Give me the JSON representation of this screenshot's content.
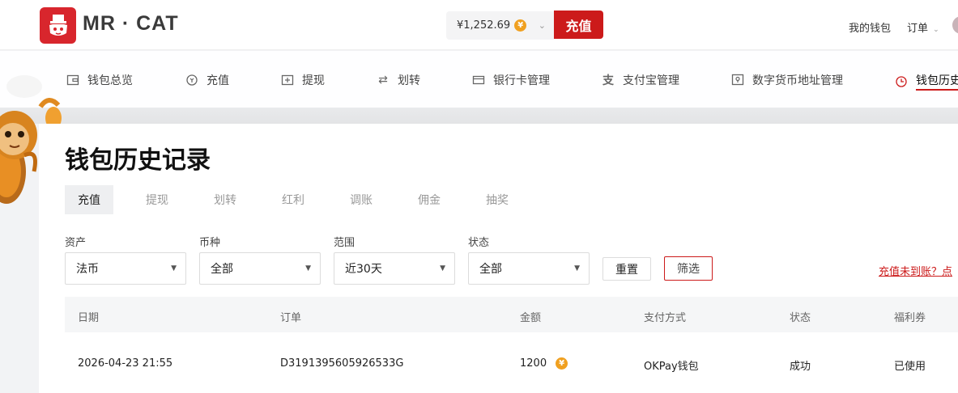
{
  "header": {
    "brand": "MR · CAT",
    "balance": "¥1,252.69",
    "coin_symbol": "¥",
    "recharge_label": "充值",
    "my_wallet": "我的钱包",
    "orders": "订单",
    "accent_color": "#cc1a1a"
  },
  "nav": {
    "items": [
      {
        "label": "钱包总览",
        "icon": "wallet-icon"
      },
      {
        "label": "充值",
        "icon": "recharge-icon"
      },
      {
        "label": "提现",
        "icon": "withdraw-icon"
      },
      {
        "label": "划转",
        "icon": "transfer-icon"
      },
      {
        "label": "银行卡管理",
        "icon": "bank-card-icon"
      },
      {
        "label": "支付宝管理",
        "icon": "alipay-icon"
      },
      {
        "label": "数字货币地址管理",
        "icon": "crypto-address-icon"
      },
      {
        "label": "钱包历史",
        "icon": "clock-icon",
        "active": true
      }
    ]
  },
  "main": {
    "title": "钱包历史记录",
    "tabs": [
      "充值",
      "提现",
      "划转",
      "红利",
      "调账",
      "佣金",
      "抽奖"
    ],
    "active_tab": "充值",
    "filters": [
      {
        "label": "资产",
        "value": "法币"
      },
      {
        "label": "币种",
        "value": "全部"
      },
      {
        "label": "范围",
        "value": "近30天"
      },
      {
        "label": "状态",
        "value": "全部"
      }
    ],
    "reset_label": "重置",
    "filter_label": "筛选",
    "help_link": "充值未到账？点",
    "table": {
      "columns": [
        "日期",
        "订单",
        "金额",
        "支付方式",
        "状态",
        "福利券"
      ],
      "rows": [
        {
          "date": "2026-04-23 21:55",
          "order": "D3191395605926533G",
          "amount": "1200",
          "method": "OKPay钱包",
          "status": "成功",
          "coupon": "已使用"
        }
      ]
    }
  }
}
